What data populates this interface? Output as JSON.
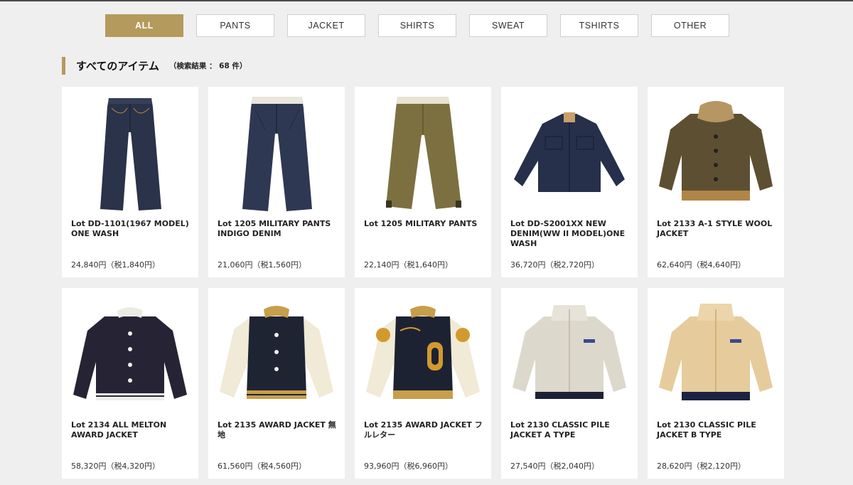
{
  "tabs": [
    {
      "label": "ALL",
      "active": true
    },
    {
      "label": "PANTS",
      "active": false
    },
    {
      "label": "JACKET",
      "active": false
    },
    {
      "label": "SHIRTS",
      "active": false
    },
    {
      "label": "SWEAT",
      "active": false
    },
    {
      "label": "TSHIRTS",
      "active": false
    },
    {
      "label": "OTHER",
      "active": false
    }
  ],
  "section": {
    "title": "すべてのアイテム",
    "count": "（検索結果 ： 68 件）"
  },
  "colors": {
    "accent": "#b59a5d",
    "page_bg": "#efefef"
  },
  "products": [
    {
      "name": "Lot DD-1101(1967 MODEL) ONE WASH",
      "price": "24,840円（税1,840円）",
      "icon": "jeans-icon"
    },
    {
      "name": "Lot 1205 MILITARY PANTS INDIGO DENIM",
      "price": "21,060円（税1,560円）",
      "icon": "denim-pants-icon"
    },
    {
      "name": "Lot 1205 MILITARY PANTS",
      "price": "22,140円（税1,640円）",
      "icon": "chino-pants-icon"
    },
    {
      "name": "Lot DD-S2001XX NEW DENIM(WW II MODEL)ONE WASH",
      "price": "36,720円（税2,720円）",
      "icon": "denim-jacket-icon"
    },
    {
      "name": "Lot 2133 A-1 STYLE WOOL JACKET",
      "price": "62,640円（税4,640円）",
      "icon": "wool-jacket-icon"
    },
    {
      "name": "Lot 2134 ALL MELTON AWARD JACKET",
      "price": "58,320円（税4,320円）",
      "icon": "melton-jacket-icon"
    },
    {
      "name": "Lot 2135 AWARD JACKET 無地",
      "price": "61,560円（税4,560円）",
      "icon": "award-jacket-icon"
    },
    {
      "name": "Lot 2135 AWARD JACKET フルレター",
      "price": "93,960円（税6,960円）",
      "icon": "award-jacket-letter-icon"
    },
    {
      "name": "Lot 2130 CLASSIC PILE JACKET A TYPE",
      "price": "27,540円（税2,040円）",
      "icon": "pile-jacket-a-icon"
    },
    {
      "name": "Lot 2130 CLASSIC PILE JACKET B TYPE",
      "price": "28,620円（税2,120円）",
      "icon": "pile-jacket-b-icon"
    }
  ]
}
